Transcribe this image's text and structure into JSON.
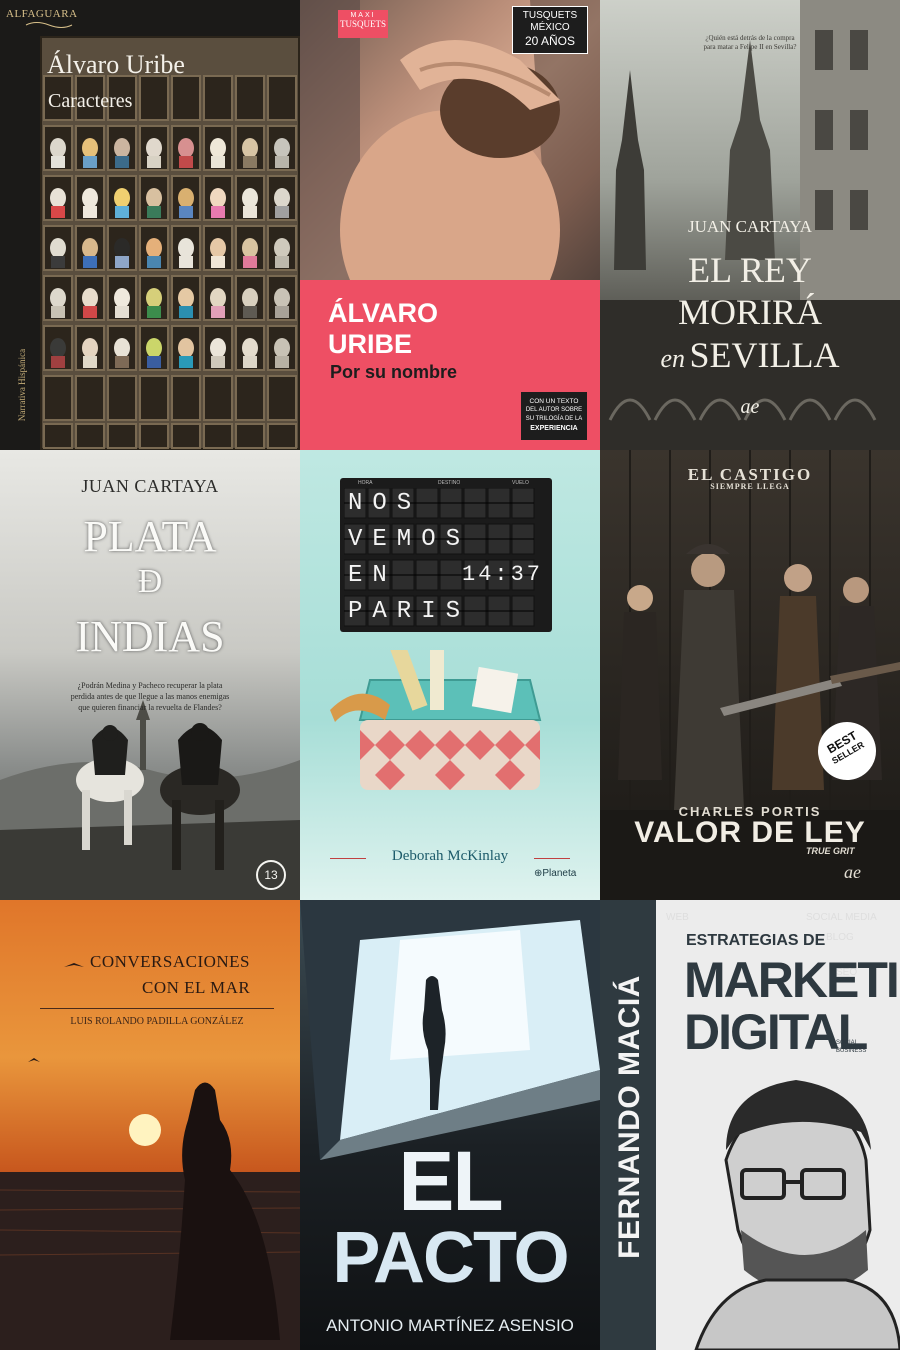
{
  "covers": [
    {
      "publisher": "ALFAGUARA",
      "author": "Álvaro Uribe",
      "title": "Caracteres",
      "spine": "Narrativa Hispánica"
    },
    {
      "imprint_top": "MAXI",
      "imprint_name": "TUSQUETS",
      "badge": [
        "TUSQUETS",
        "MÉXICO",
        "20 AÑOS"
      ],
      "author_line1": "ÁLVARO",
      "author_line2": "URIBE",
      "title": "Por su nombre",
      "note": [
        "CON UN TEXTO",
        "DEL AUTOR SOBRE",
        "SU TRILOGÍA DE LA",
        "EXPERIENCIA"
      ]
    },
    {
      "tagline_line1": "¿Quién está detrás de la compra",
      "tagline_line2": "para matar a Felipe II en Sevilla?",
      "author": "JUAN CARTAYA",
      "title_line1": "EL REY",
      "title_line2": "MORIRÁ",
      "title_line3_prefix": "en",
      "title_line3": "SEVILLA",
      "logo": "ae"
    },
    {
      "author": "JUAN CARTAYA",
      "title_line1": "PLATA",
      "title_line2": "Ð",
      "title_line3": "INDIAS",
      "blurb": [
        "¿Podrán Medina y Pacheco recuperar la plata",
        "perdida antes de que llegue a las manos enemigas",
        "que quieren financiar la revuelta de Flandes?"
      ],
      "logo": "13"
    },
    {
      "board_headers": [
        "HORA",
        "DESTINO",
        "VUELO"
      ],
      "board_rows": [
        "NOS",
        "VEMOS",
        "EN",
        "PARIS"
      ],
      "time": "14:37",
      "author": "Deborah McKinlay",
      "publisher": "Planeta"
    },
    {
      "tagline_line1": "EL CASTIGO",
      "tagline_line2": "SIEMPRE LLEGA",
      "badge_line1": "BEST",
      "badge_line2": "SELLER",
      "author": "CHARLES PORTIS",
      "title": "VALOR DE LEY",
      "subtitle": "TRUE GRIT"
    },
    {
      "title_line1": "CONVERSACIONES",
      "title_line2": "CON EL MAR",
      "author": "LUIS ROLANDO PADILLA GONZÁLEZ"
    },
    {
      "title_line1": "EL",
      "title_line2": "PACTO",
      "author": "ANTONIO MARTÍNEZ ASENSIO"
    },
    {
      "author": "FERNANDO MACIÁ",
      "title_line1": "ESTRATEGIAS DE",
      "title_line2": "MARKETING",
      "title_line3": "DIGITAL",
      "publisher_line1": "SOCIAL",
      "publisher_line2": "BUSINESS"
    }
  ]
}
